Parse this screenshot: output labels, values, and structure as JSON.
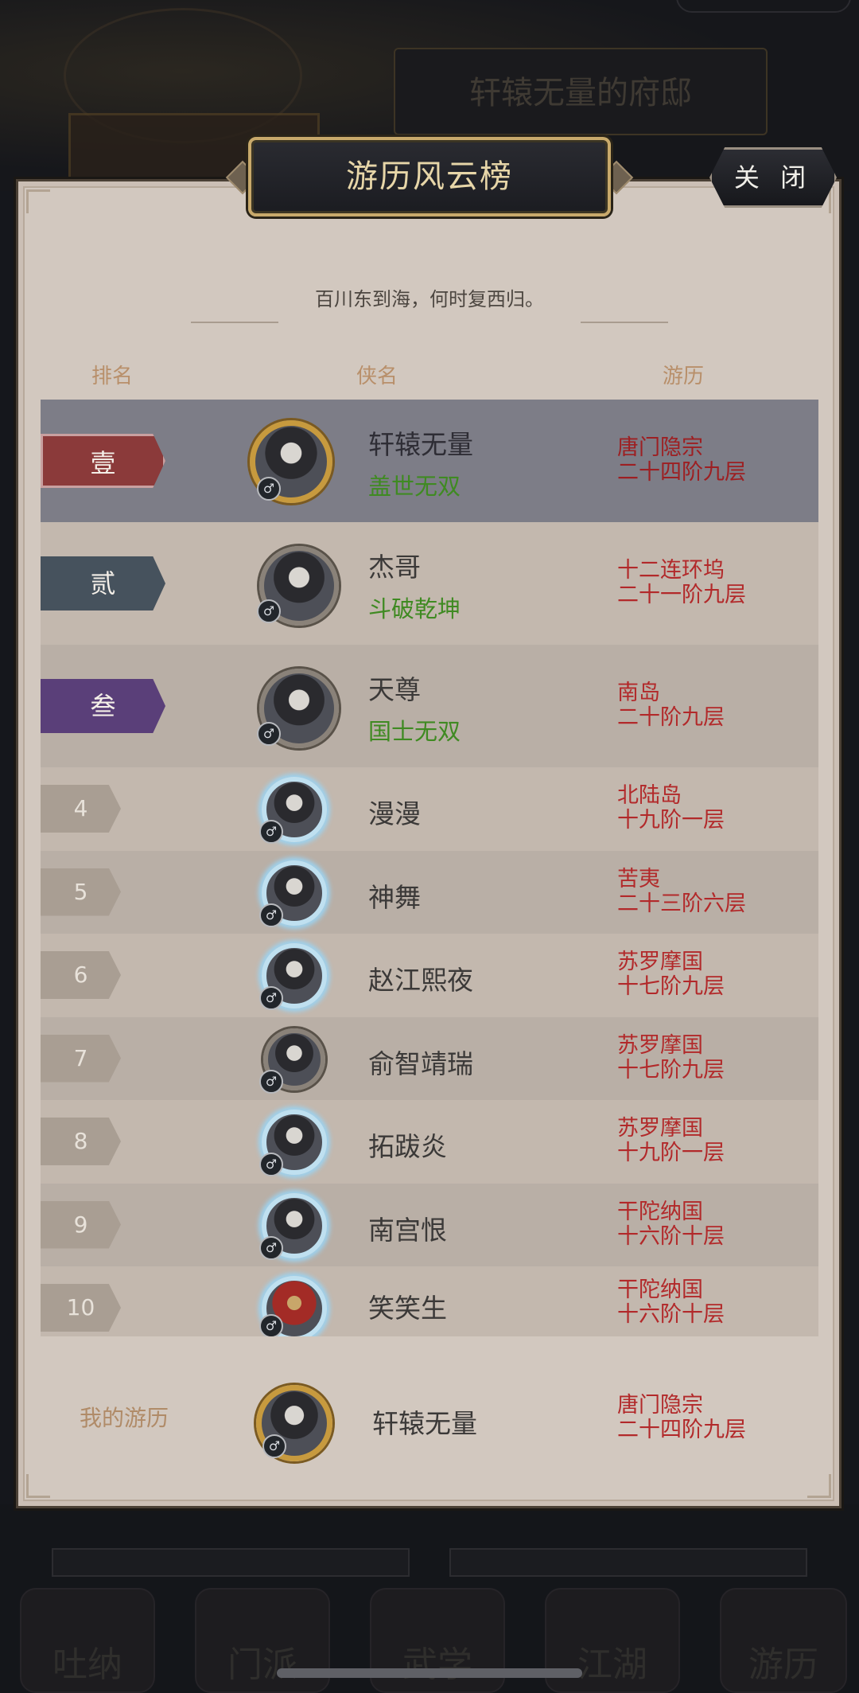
{
  "background": {
    "mansion_title": "轩辕无量的府邸",
    "nav_items": [
      "吐纳",
      "门派",
      "武学",
      "江湖",
      "游历"
    ]
  },
  "dialog": {
    "title": "游历风云榜",
    "close_label": "关 闭",
    "motto": "百川东到海，何时复西归。",
    "columns": {
      "rank": "排名",
      "name": "侠名",
      "progress": "游历"
    }
  },
  "rankings": [
    {
      "rank": "壹",
      "name": "轩辕无量",
      "title": "盖世无双",
      "location": "唐门隐宗",
      "stage": "二十四阶九层",
      "gender": "♂",
      "frame": "gold"
    },
    {
      "rank": "贰",
      "name": "杰哥",
      "title": "斗破乾坤",
      "location": "十二连环坞",
      "stage": "二十一阶九层",
      "gender": "♂",
      "frame": "steel"
    },
    {
      "rank": "叁",
      "name": "天尊",
      "title": "国士无双",
      "location": "南岛",
      "stage": "二十阶九层",
      "gender": "♂",
      "frame": "steel"
    },
    {
      "rank": "4",
      "name": "漫漫",
      "location": "北陆岛",
      "stage": "十九阶一层",
      "gender": "♂",
      "frame": "ice"
    },
    {
      "rank": "5",
      "name": "神舞",
      "location": "苦夷",
      "stage": "二十三阶六层",
      "gender": "♂",
      "frame": "ice"
    },
    {
      "rank": "6",
      "name": "赵江熙夜",
      "location": "苏罗摩国",
      "stage": "十七阶九层",
      "gender": "♂",
      "frame": "ice"
    },
    {
      "rank": "7",
      "name": "俞智靖瑞",
      "location": "苏罗摩国",
      "stage": "十七阶九层",
      "gender": "♂",
      "frame": "steel"
    },
    {
      "rank": "8",
      "name": "拓跋炎",
      "location": "苏罗摩国",
      "stage": "十九阶一层",
      "gender": "♂",
      "frame": "ice"
    },
    {
      "rank": "9",
      "name": "南宫恨",
      "location": "干陀纳国",
      "stage": "十六阶十层",
      "gender": "♂",
      "frame": "ice"
    },
    {
      "rank": "10",
      "name": "笑笑生",
      "location": "干陀纳国",
      "stage": "十六阶十层",
      "gender": "♂",
      "frame": "ice"
    }
  ],
  "my_record": {
    "label": "我的游历",
    "name": "轩辕无量",
    "location": "唐门隐宗",
    "stage": "二十四阶九层",
    "gender": "♂"
  }
}
